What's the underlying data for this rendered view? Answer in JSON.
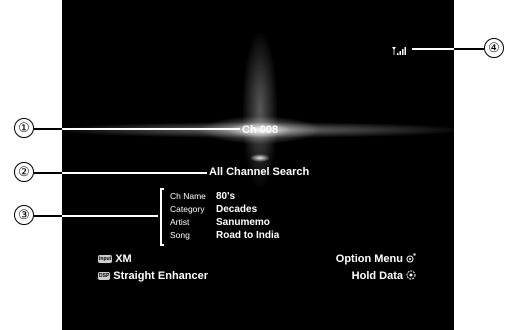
{
  "channel": {
    "label": "Ch 008"
  },
  "search_mode": {
    "label": "All Channel Search"
  },
  "info": {
    "rows": [
      {
        "label": "Ch Name",
        "value": "80's"
      },
      {
        "label": "Category",
        "value": "Decades"
      },
      {
        "label": "Artist",
        "value": "Sanumemo"
      },
      {
        "label": "Song",
        "value": "Road to India"
      }
    ]
  },
  "bottom": {
    "input_badge": "input",
    "input_label": "XM",
    "dsp_badge": "DSP",
    "dsp_label": "Straight Enhancer",
    "option_menu": "Option Menu",
    "hold_data": "Hold Data"
  },
  "signal_icon": "signal-strength-icon",
  "callouts": [
    "①",
    "②",
    "③",
    "④"
  ],
  "colors": {
    "screen": "#000000",
    "text": "#ffffff"
  }
}
